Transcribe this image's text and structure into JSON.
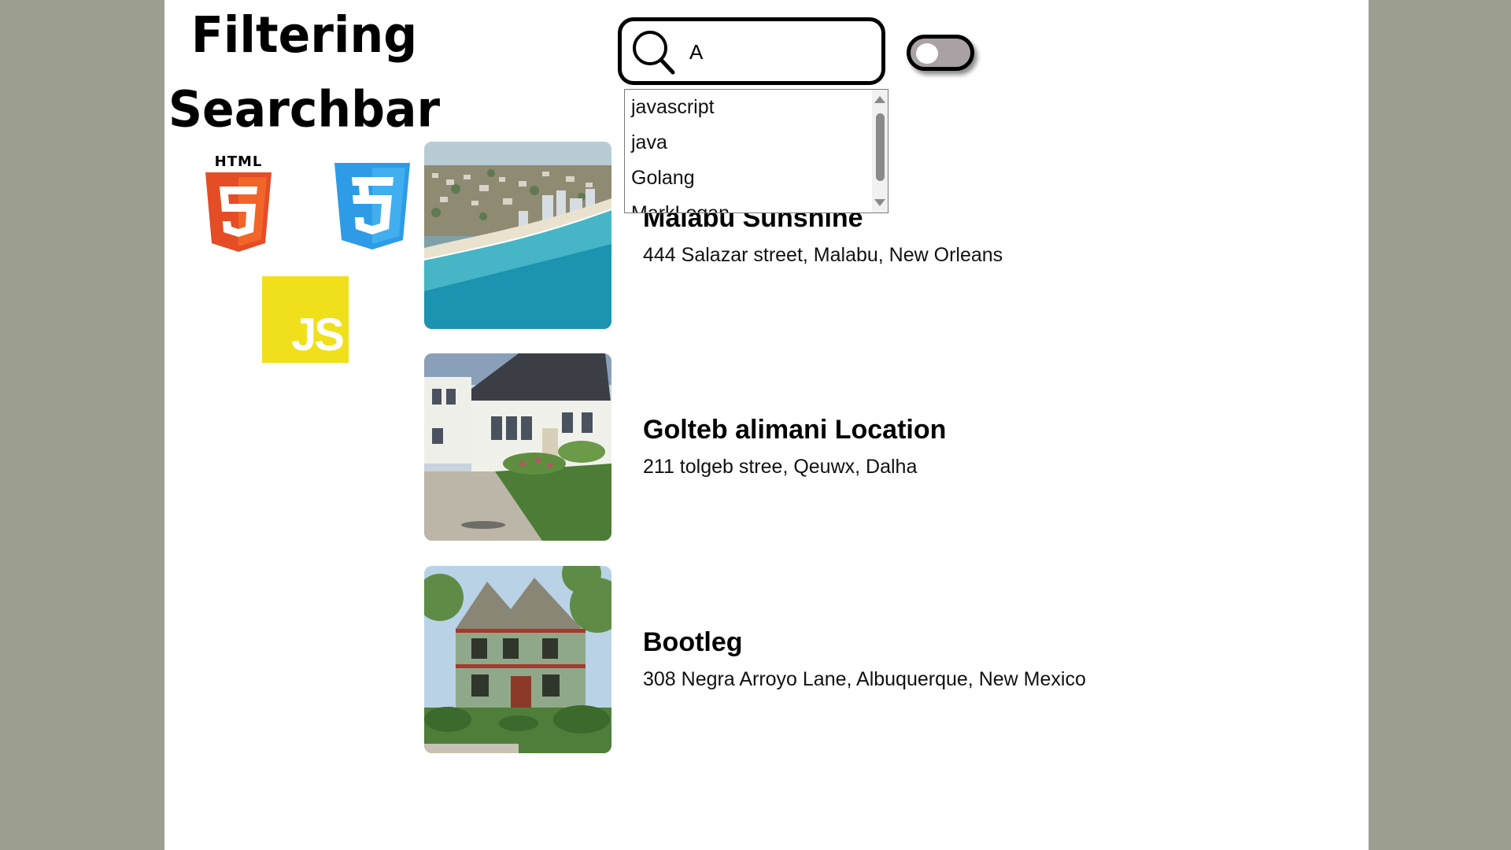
{
  "brand": {
    "title_line1": "Filtering",
    "title_line2": "Searchbar",
    "html_logo_caption": "HTML",
    "js_logo_text": "JS"
  },
  "search": {
    "value": "A",
    "placeholder": ""
  },
  "toggle": {
    "state": "off"
  },
  "dropdown": {
    "items": [
      "javascript",
      "java",
      "Golang",
      "MarkLogan"
    ]
  },
  "listings": [
    {
      "title": "Malabu Sunshine",
      "address": "444 Salazar street, Malabu, New Orleans",
      "image": "beach-coast-photo"
    },
    {
      "title": "Golteb alimani Location",
      "address": "211 tolgeb stree, Qeuwx, Dalha",
      "image": "white-house-photo"
    },
    {
      "title": "Bootleg",
      "address": "308 Negra Arroyo Lane, Albuquerque, New Mexico",
      "image": "green-victorian-house-photo"
    }
  ],
  "colors": {
    "background": "#9c9e8f",
    "panel": "#ffffff",
    "html_orange": "#e44d26",
    "css_blue": "#2d9be6",
    "js_yellow": "#f0e01c",
    "toggle_track": "#a9a1a3"
  }
}
